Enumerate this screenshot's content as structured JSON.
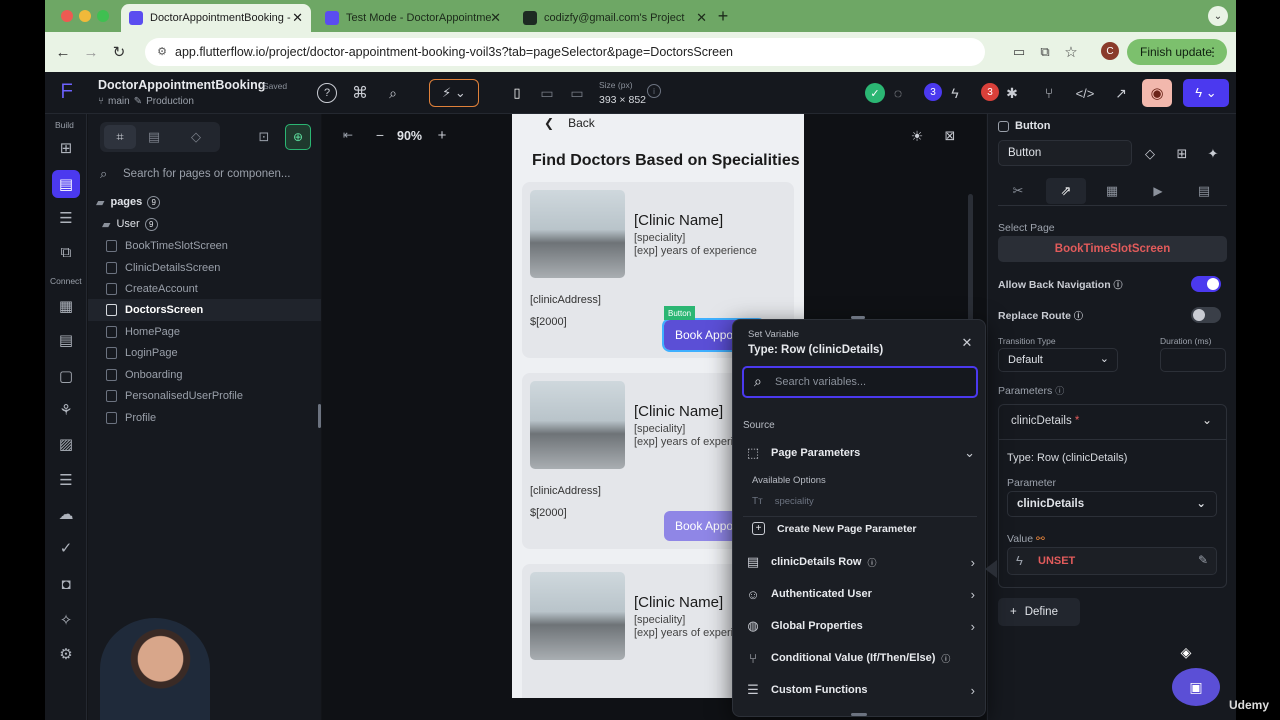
{
  "browser": {
    "tabs": [
      {
        "title": "DoctorAppointmentBooking -",
        "active": true
      },
      {
        "title": "Test Mode - DoctorAppointme",
        "active": false
      },
      {
        "title": "codizfy@gmail.com's Project",
        "active": false
      }
    ],
    "url": "app.flutterflow.io/project/doctor-appointment-booking-voil3s?tab=pageSelector&page=DoctorsScreen",
    "profile_initial": "C",
    "finish_update": "Finish update"
  },
  "project": {
    "name": "DoctorAppointmentBooking",
    "saved": "Saved",
    "branch": "main",
    "env": "Production"
  },
  "toolbar": {
    "size_label": "Size (px)",
    "size_value": "393 × 852",
    "badge_a": "3",
    "badge_b": "3",
    "zoom": "90%"
  },
  "rail": {
    "build_label": "Build",
    "connect_label": "Connect"
  },
  "tree": {
    "search_placeholder": "Search for pages or componen...",
    "pages_label": "pages",
    "pages_count": "9",
    "folder_label": "User",
    "folder_count": "9",
    "items": [
      "BookTimeSlotScreen",
      "ClinicDetailsScreen",
      "CreateAccount",
      "DoctorsScreen",
      "HomePage",
      "LoginPage",
      "Onboarding",
      "PersonalisedUserProfile",
      "Profile"
    ]
  },
  "phone": {
    "back": "Back",
    "heading": "Find Doctors Based on Specialities",
    "cards": [
      {
        "name": "[Clinic Name]",
        "speciality": "[speciality]",
        "exp": "[exp] years of experience",
        "address": "[clinicAddress]",
        "price": "$[2000]",
        "book": "Book Appo"
      },
      {
        "name": "[Clinic Name]",
        "speciality": "[speciality]",
        "exp": "[exp] years of experi",
        "address": "[clinicAddress]",
        "price": "$[2000]",
        "book": "Book Appo"
      },
      {
        "name": "[Clinic Name]",
        "speciality": "[speciality]",
        "exp": "[exp] years of experi"
      }
    ],
    "selected_tag": "Button"
  },
  "props": {
    "widget_type": "Button",
    "widget_name": "Button",
    "select_page_label": "Select Page",
    "selected_page": "BookTimeSlotScreen",
    "allow_back": "Allow Back Navigation",
    "replace_route": "Replace Route",
    "transition_type_label": "Transition Type",
    "transition_type": "Default",
    "duration_label": "Duration (ms)",
    "parameters_label": "Parameters",
    "param_name": "clinicDetails",
    "param_required": "*",
    "param_type": "Type: Row (clinicDetails)",
    "parameter_label": "Parameter",
    "parameter_value": "clinicDetails",
    "value_label": "Value",
    "value": "UNSET",
    "define": "Define"
  },
  "popup": {
    "title": "Set Variable",
    "type": "Type: Row (clinicDetails)",
    "search_placeholder": "Search variables...",
    "source_label": "Source",
    "page_parameters": "Page Parameters",
    "available_options": "Available Options",
    "speciality_option": "speciality",
    "create_param": "Create New Page Parameter",
    "clinic_row": "clinicDetails Row",
    "auth_user": "Authenticated User",
    "global_props": "Global Properties",
    "conditional": "Conditional Value (If/Then/Else)",
    "custom_functions": "Custom Functions"
  },
  "watermark": "Udemy",
  "colors": {
    "accent": "#4b39ef",
    "selected_page": "#e25b5b",
    "unset": "#e25b5b",
    "tab_bar": "#6ea765"
  }
}
